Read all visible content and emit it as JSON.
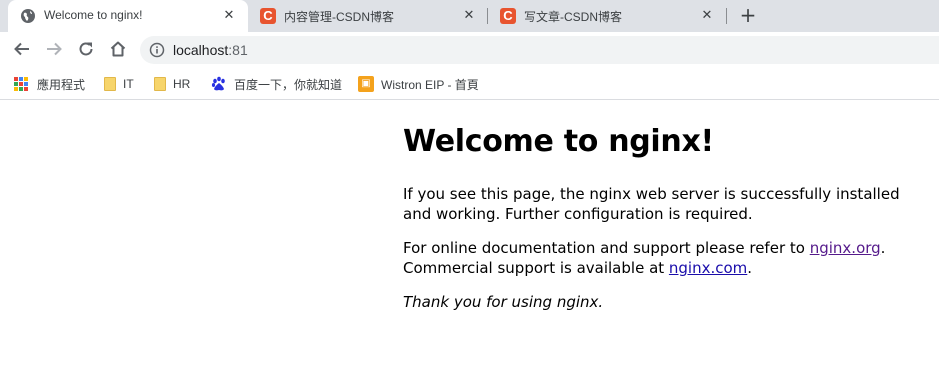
{
  "tabs": [
    {
      "title": "Welcome to nginx!",
      "favicon": "globe-icon",
      "active": true
    },
    {
      "title": "内容管理-CSDN博客",
      "favicon": "csdn-icon",
      "active": false
    },
    {
      "title": "写文章-CSDN博客",
      "favicon": "csdn-icon",
      "active": false
    }
  ],
  "tab_close_glyph": "✕",
  "new_tab_glyph": "+",
  "toolbar": {
    "back": "arrow-left-icon",
    "forward": "arrow-right-icon",
    "reload": "reload-icon",
    "home": "home-icon"
  },
  "omnibox": {
    "host": "localhost",
    "port": ":81",
    "security_icon": "info-icon"
  },
  "bookmarks": [
    {
      "label": "應用程式",
      "icon": "apps-grid-icon"
    },
    {
      "label": "IT",
      "icon": "folder-icon"
    },
    {
      "label": "HR",
      "icon": "folder-icon"
    },
    {
      "label": "百度一下，你就知道",
      "icon": "baidu-paw-icon"
    },
    {
      "label": "Wistron EIP - 首頁",
      "icon": "wistron-icon"
    }
  ],
  "csdn_letter": "C",
  "page": {
    "heading": "Welcome to nginx!",
    "para1": "If you see this page, the nginx web server is successfully installed and working. Further configuration is required.",
    "para2_prefix": "For online documentation and support please refer to ",
    "link_org": "nginx.org",
    "para2_mid": ".\nCommercial support is available at ",
    "link_com": "nginx.com",
    "para2_suffix": ".",
    "thanks": "Thank you for using nginx."
  },
  "colors": {
    "tabstrip_bg": "#dee1e6",
    "csdn_brand": "#e8542f",
    "link": "#1a0dab",
    "link_visited": "#551a8b",
    "folder": "#f7d56b"
  }
}
